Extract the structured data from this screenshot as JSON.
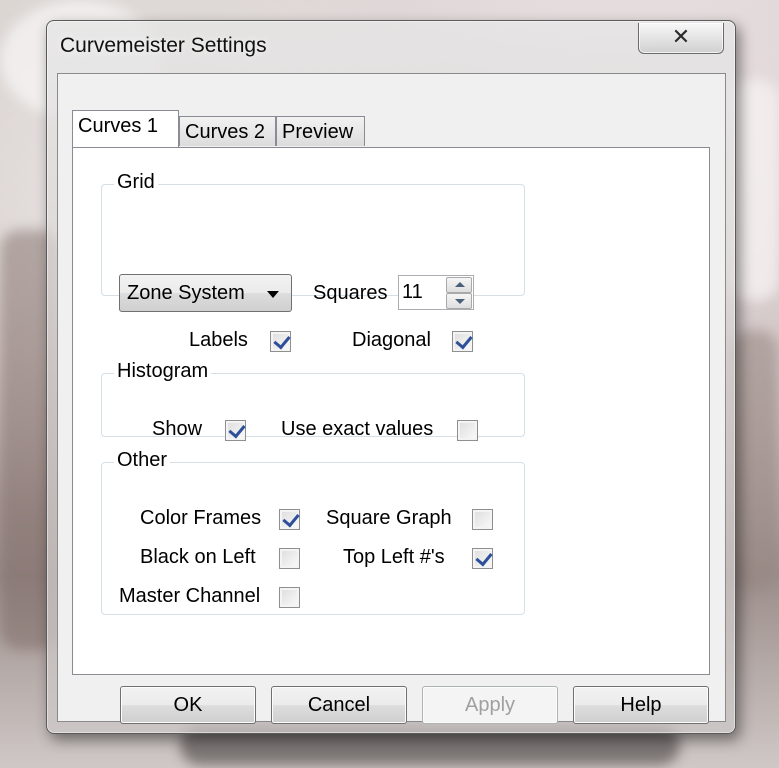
{
  "window": {
    "title": "Curvemeister Settings",
    "close_symbol": "✕"
  },
  "tabs": [
    {
      "label": "Curves 1",
      "active": true
    },
    {
      "label": "Curves 2",
      "active": false
    },
    {
      "label": "Preview",
      "active": false
    }
  ],
  "grid": {
    "group_label": "Grid",
    "dropdown_value": "Zone System",
    "squares_label": "Squares",
    "squares_value": "11",
    "labels_label": "Labels",
    "labels_checked": true,
    "diagonal_label": "Diagonal",
    "diagonal_checked": true
  },
  "histogram": {
    "group_label": "Histogram",
    "show_label": "Show",
    "show_checked": true,
    "exact_label": "Use exact values",
    "exact_checked": false
  },
  "other": {
    "group_label": "Other",
    "color_frames_label": "Color Frames",
    "color_frames_checked": true,
    "square_graph_label": "Square Graph",
    "square_graph_checked": false,
    "black_on_left_label": "Black on Left",
    "black_on_left_checked": false,
    "top_left_label": "Top Left #'s",
    "top_left_checked": true,
    "master_channel_label": "Master Channel",
    "master_channel_checked": false
  },
  "buttons": {
    "ok": "OK",
    "cancel": "Cancel",
    "apply": "Apply",
    "help": "Help"
  },
  "icons": {
    "dropdown_arrow": "chevron-down-icon",
    "spin_up": "arrow-up-icon",
    "spin_down": "arrow-down-icon",
    "checkmark": "checkmark-icon"
  },
  "colors": {
    "checkmark": "#2e4f9a",
    "disabled_text": "#a0a0a0"
  }
}
